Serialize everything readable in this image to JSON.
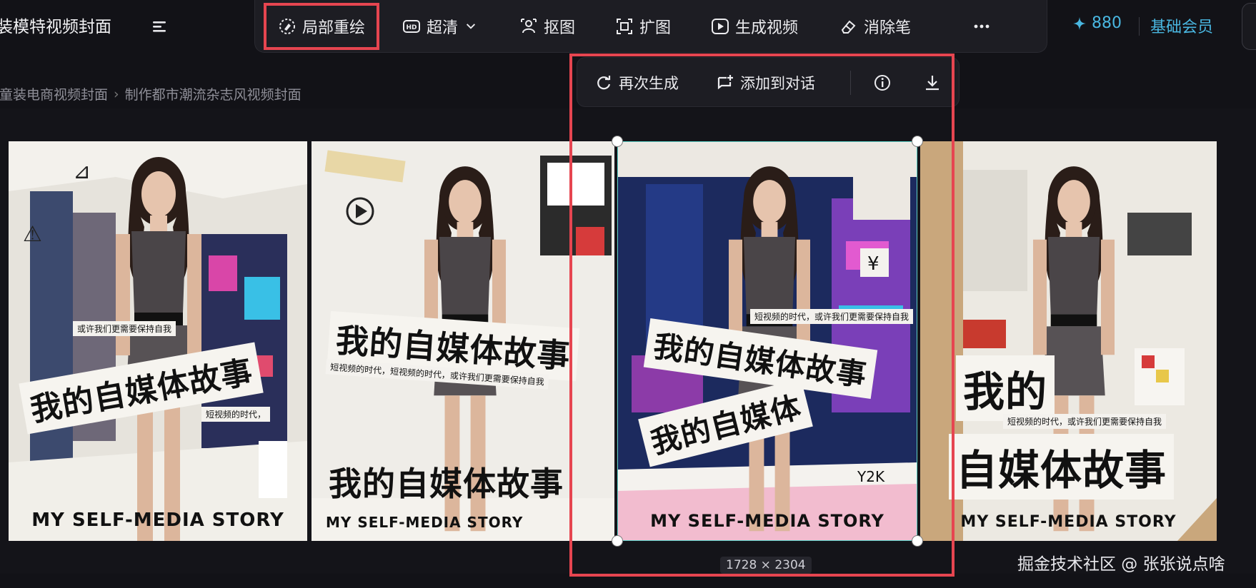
{
  "header": {
    "project_title": "服装模特视频封面",
    "credits": "880",
    "membership": "基础会员"
  },
  "toolbar": {
    "inpaint": "局部重绘",
    "hd": "超清",
    "cutout": "抠图",
    "expand": "扩图",
    "make_video": "生成视频",
    "eraser": "消除笔"
  },
  "breadcrumb": {
    "parent": "成童装电商视频封面",
    "current": "制作都市潮流杂志风视频封面"
  },
  "image_actions": {
    "regenerate": "再次生成",
    "add_to_chat": "添加到对话"
  },
  "posters": [
    {
      "headline": "我的自媒体故事",
      "subtitle": "短视频的时代，或许我们更需要保持自我",
      "subtitle2": "短视频的时代，",
      "subtitle3": "或许我们更需要保持自我",
      "story": "MY SELF-MEDIA STORY"
    },
    {
      "headline": "我的自媒体故事",
      "subtitle": "短视频的时代，短视频的时代，或许我们更需要保持自我",
      "headline2": "我的自媒体故事",
      "story": "MY SELF-MEDIA STORY"
    },
    {
      "headline": "我的自媒体故事",
      "subtitle": "短视频的时代，或许我们更需要保持自我",
      "headline2": "我的自媒体",
      "story": "MY SELF-MEDIA STORY",
      "tag": "Y2K"
    },
    {
      "headline": "我的",
      "subtitle": "短视频的时代，或许我们更需要保持自我",
      "headline2": "自媒体故事",
      "story": "MY SELF-MEDIA STORY"
    }
  ],
  "selected_image": {
    "dimensions": "1728 × 2304"
  },
  "watermark": "掘金技术社区 @ 张张说点啥",
  "colors": {
    "accent_blue": "#49b6e0",
    "highlight_red": "#e64550",
    "selection_teal": "#5fd1c8"
  }
}
